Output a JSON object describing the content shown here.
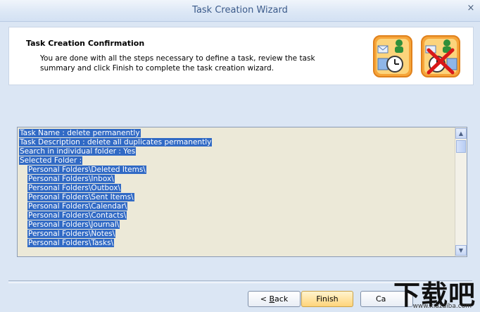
{
  "window": {
    "title": "Task Creation Wizard",
    "close_glyph": "×"
  },
  "header": {
    "title": "Task Creation Confirmation",
    "description": "You are done with all the steps necessary to define a task, review the task summary and click Finish to complete the task creation wizard.",
    "icons": [
      "task-clock-icon",
      "task-delete-icon"
    ]
  },
  "summary": {
    "lines": [
      {
        "text": "Task Name : delete permanently",
        "indent": false
      },
      {
        "text": "Task Description : delete all duplicates permanently",
        "indent": false
      },
      {
        "text": "Search in individual folder : Yes",
        "indent": false
      },
      {
        "text": "Selected Folder :",
        "indent": false
      },
      {
        "text": "Personal Folders\\Deleted Items\\",
        "indent": true
      },
      {
        "text": "Personal Folders\\Inbox\\",
        "indent": true
      },
      {
        "text": "Personal Folders\\Outbox\\",
        "indent": true
      },
      {
        "text": "Personal Folders\\Sent Items\\",
        "indent": true
      },
      {
        "text": "Personal Folders\\Calendar\\",
        "indent": true
      },
      {
        "text": "Personal Folders\\Contacts\\",
        "indent": true
      },
      {
        "text": "Personal Folders\\Journal\\",
        "indent": true
      },
      {
        "text": "Personal Folders\\Notes\\",
        "indent": true
      },
      {
        "text": "Personal Folders\\Tasks\\",
        "indent": true
      }
    ],
    "selection_color": "#316ac5"
  },
  "buttons": {
    "back_prefix": "< ",
    "back_underline": "B",
    "back_rest": "ack",
    "finish": "Finish",
    "cancel": "Ca"
  },
  "watermark": {
    "big": "下载吧",
    "small": "www.xiazaiba.com"
  },
  "colors": {
    "accent": "#316ac5",
    "window_bg": "#dbe6f4"
  }
}
